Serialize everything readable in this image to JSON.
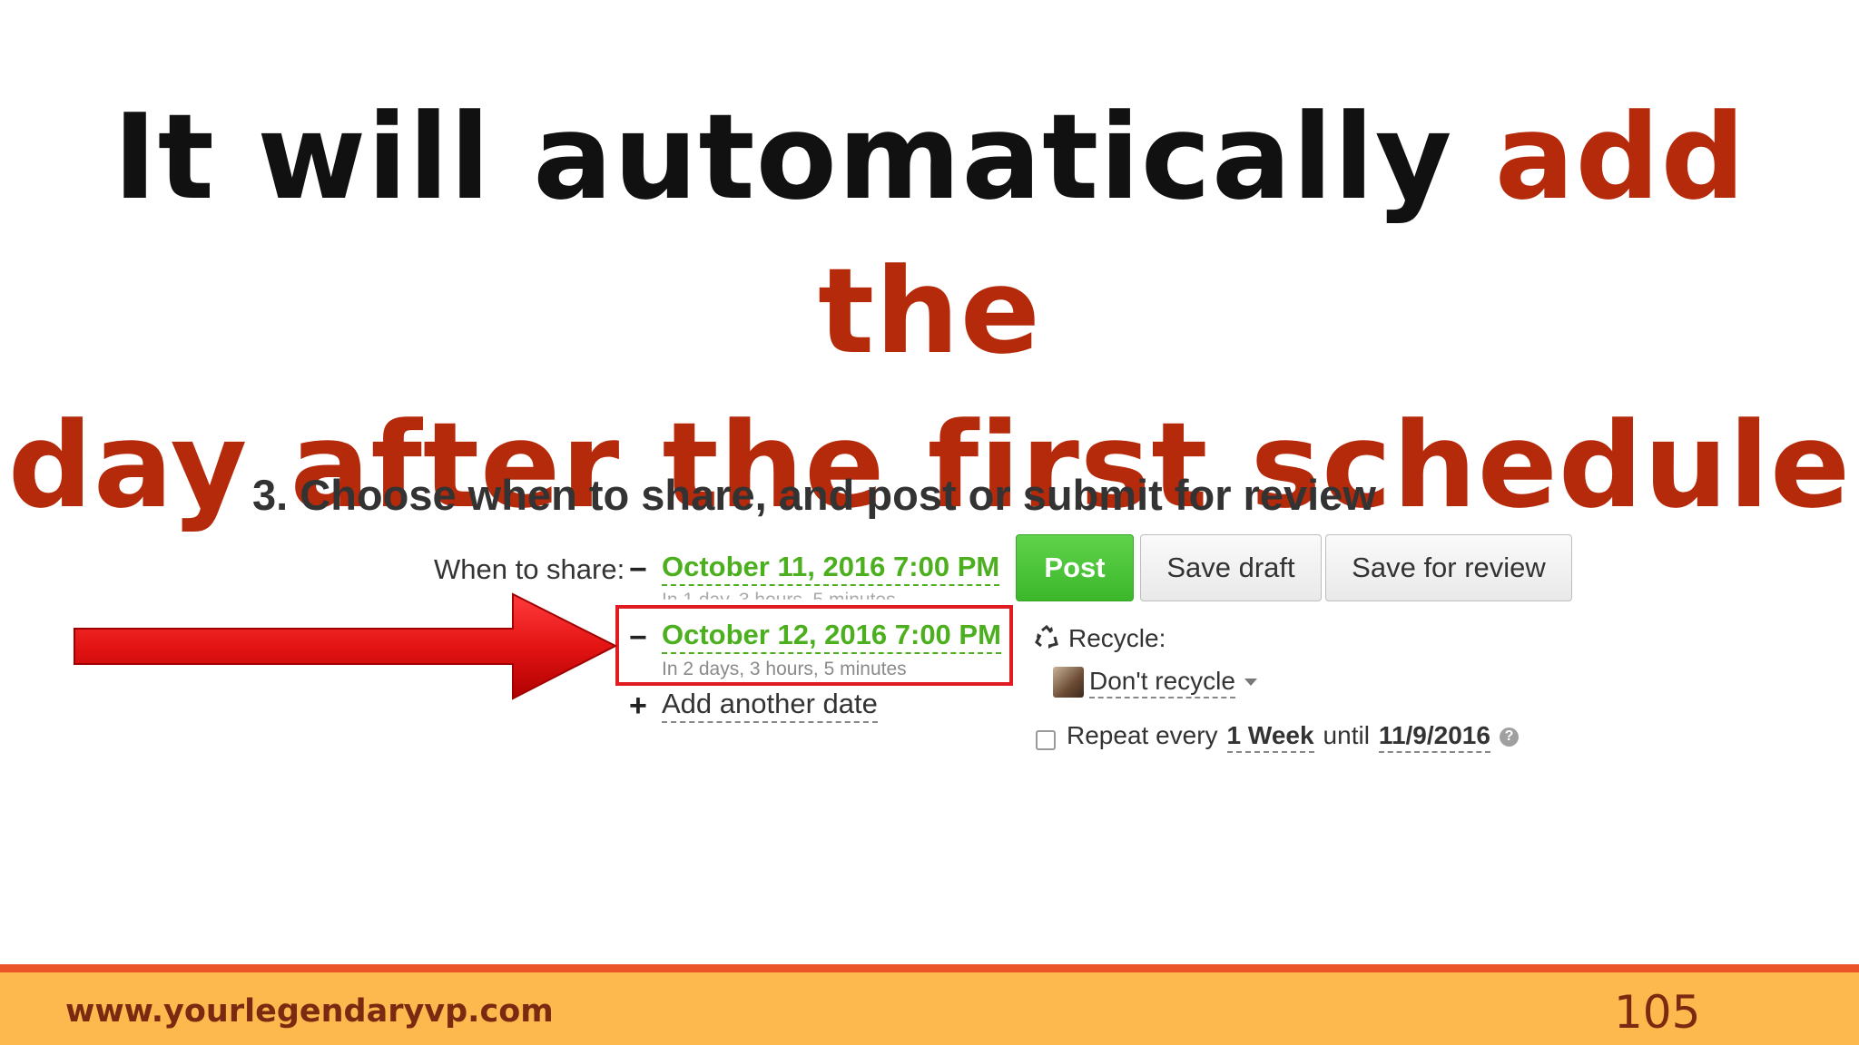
{
  "slide": {
    "title_black": "It will automatically ",
    "title_red": "add the day after the first schedule",
    "title_red_line1": "add the",
    "title_red_line2": "day after the first schedule"
  },
  "scheduler": {
    "heading": "3. Choose when to share, and post or submit for review",
    "when_label": "When to share:",
    "dates": [
      {
        "sign": "−",
        "value": "October 11, 2016 7:00 PM",
        "relative": "In 1 day, 3 hours, 5 minutes"
      },
      {
        "sign": "−",
        "value": "October 12, 2016 7:00 PM",
        "relative": "In 2 days, 3 hours, 5 minutes"
      }
    ],
    "add_sign": "+",
    "add_date_label": "Add another date",
    "buttons": {
      "post": "Post",
      "save_draft": "Save draft",
      "save_review": "Save for review"
    },
    "recycle_label": "Recycle:",
    "recycle_value": "Don't recycle",
    "repeat": {
      "prefix": "Repeat every",
      "interval": "1 Week",
      "until_word": "until",
      "until_date": "11/9/2016",
      "help": "?"
    }
  },
  "footer": {
    "url": "www.yourlegendaryvp.com",
    "page_number": "105"
  },
  "colors": {
    "title_red": "#b62a0c",
    "date_green": "#4caf1e",
    "post_green": "#3cb72a",
    "highlight_red": "#e01b22",
    "footer_bar": "#fdb94e",
    "footer_line": "#ea5427"
  }
}
